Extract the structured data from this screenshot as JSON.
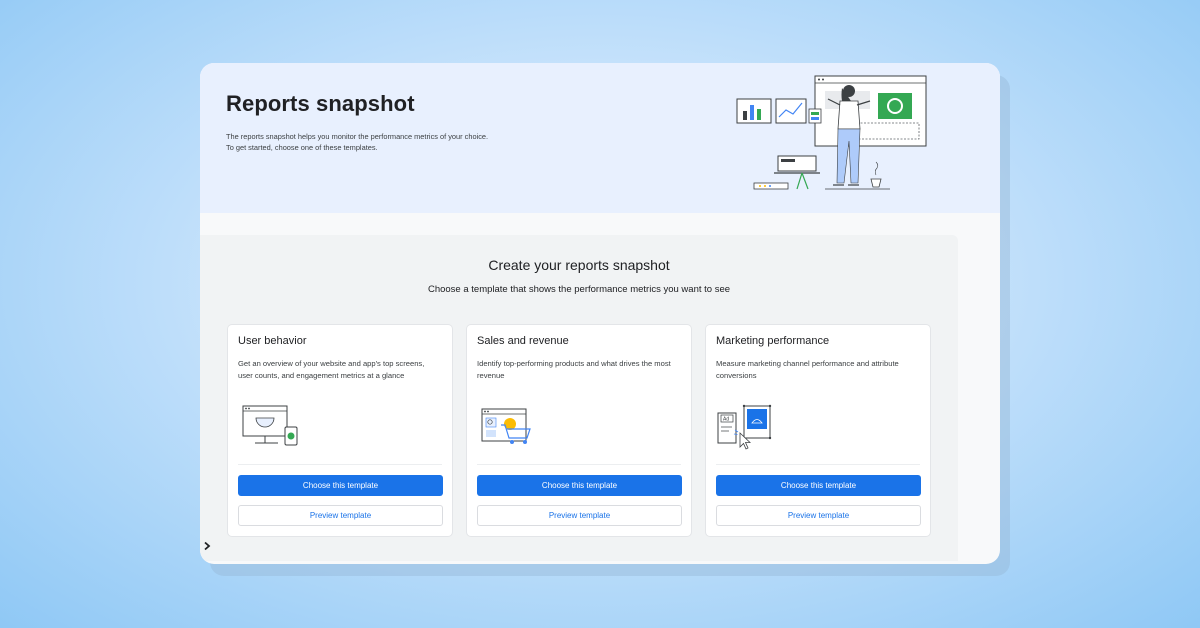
{
  "header": {
    "title": "Reports snapshot",
    "description_line1": "The reports snapshot helps you monitor the performance metrics of your choice.",
    "description_line2": "To get started, choose one of these templates."
  },
  "main": {
    "title": "Create your reports snapshot",
    "subtitle": "Choose a template that shows the performance metrics you want to see",
    "cards": [
      {
        "title": "User behavior",
        "description": "Get an overview of your website and app's top screens, user counts, and engagement metrics at a glance",
        "icon": "monitor-phone-icon",
        "primary_label": "Choose this template",
        "secondary_label": "Preview template"
      },
      {
        "title": "Sales and revenue",
        "description": "Identify top-performing products and what drives the most revenue",
        "icon": "shopping-cart-icon",
        "primary_label": "Choose this template",
        "secondary_label": "Preview template"
      },
      {
        "title": "Marketing performance",
        "description": "Measure marketing channel performance and attribute conversions",
        "icon": "ad-click-icon",
        "primary_label": "Choose this template",
        "secondary_label": "Preview template"
      }
    ]
  },
  "illustrations": {
    "ad_label": "Ad"
  },
  "colors": {
    "accent": "#1a73e8",
    "hero_background": "#e8f0fe",
    "panel_background": "#f1f3f4",
    "green_accent": "#34a853",
    "yellow_accent": "#fbbc04"
  }
}
